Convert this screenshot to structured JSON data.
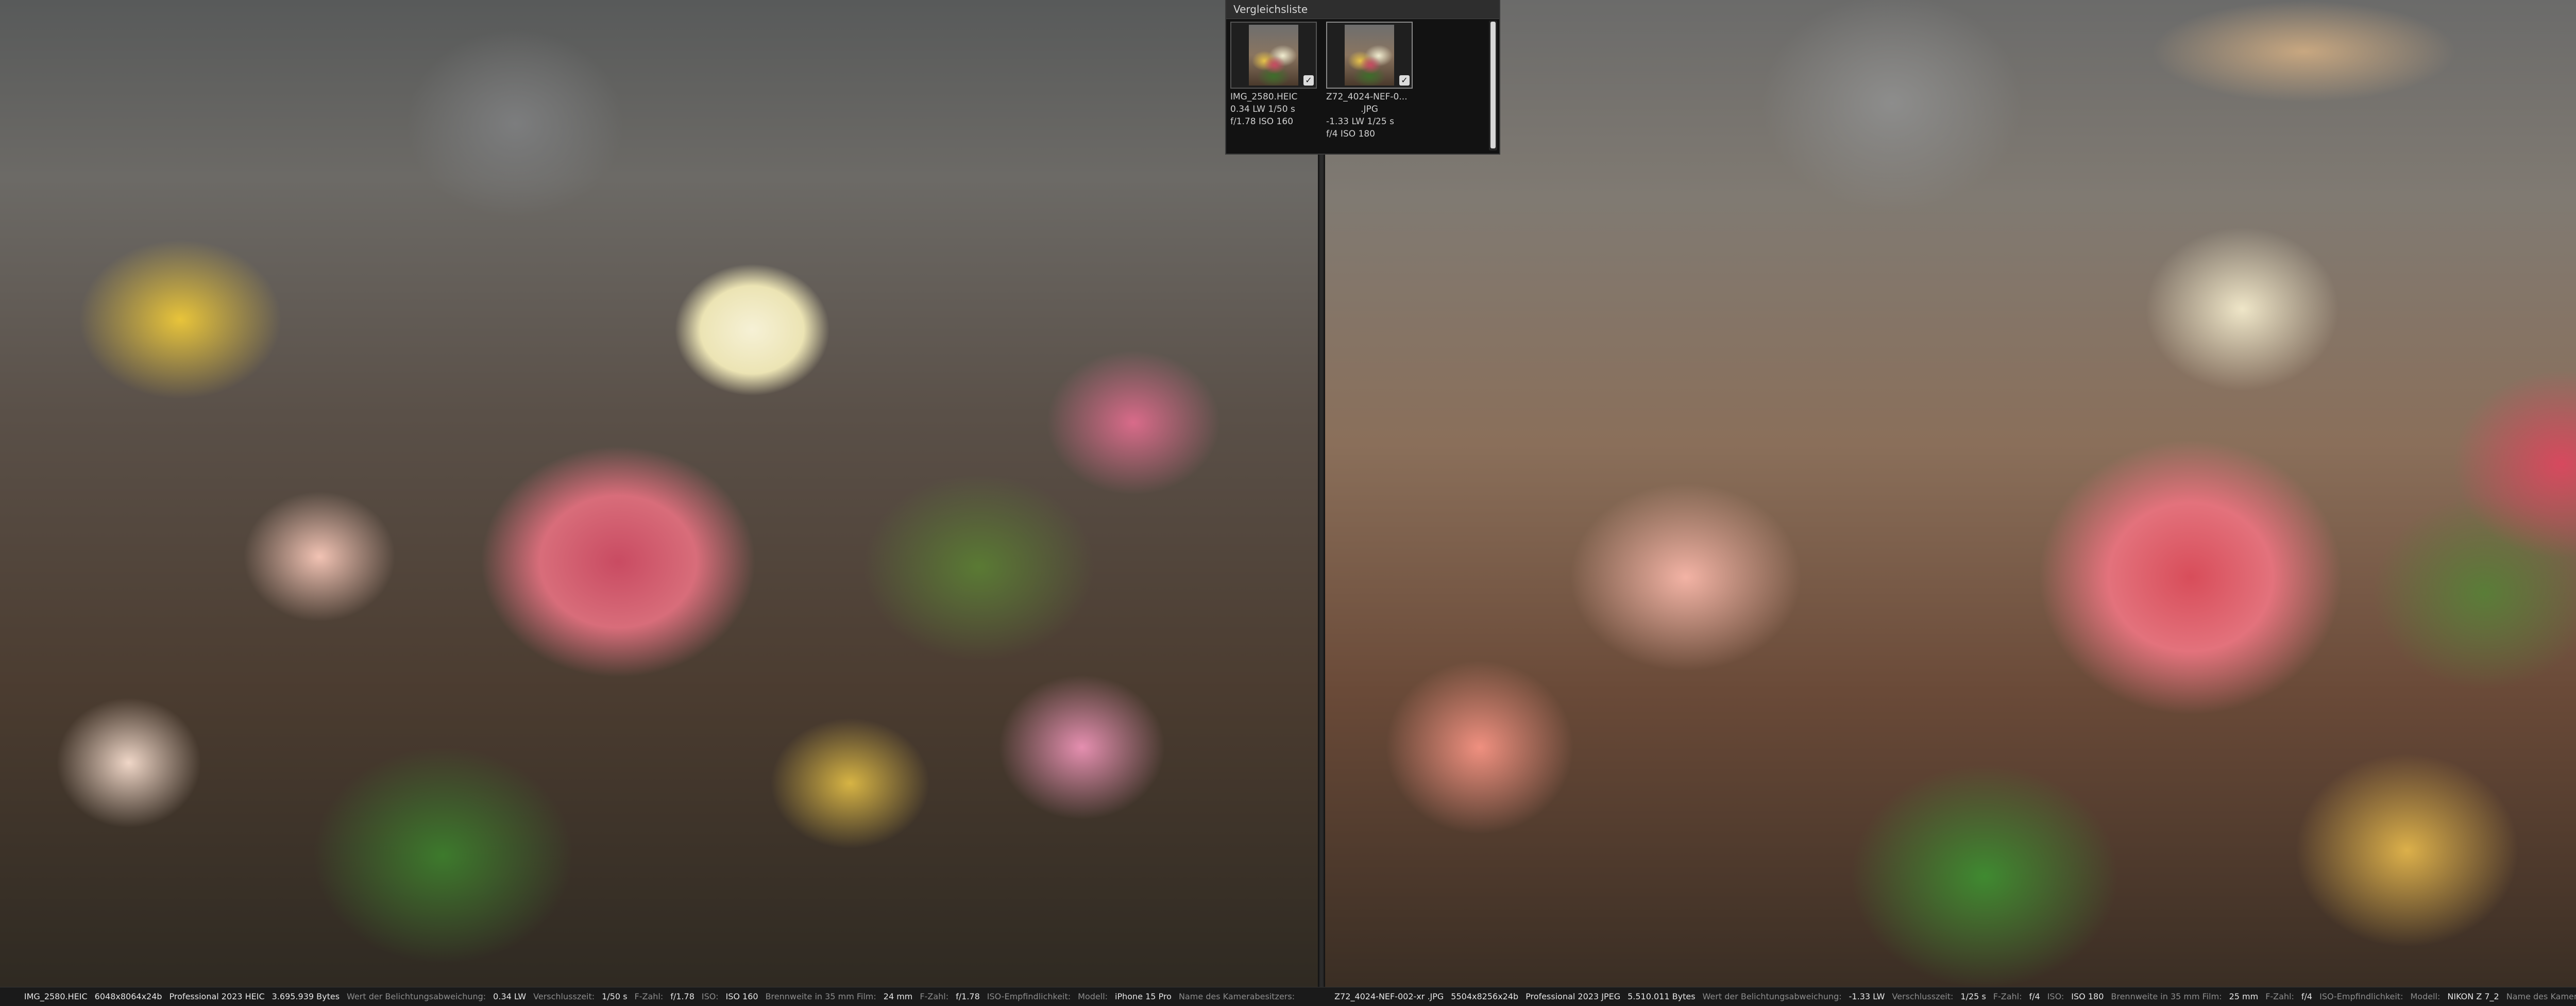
{
  "compare_panel": {
    "title": "Vergleichsliste",
    "items": [
      {
        "filename": "IMG_2580.HEIC",
        "line2": "0.34 LW   1/50 s",
        "line3": "f/1.78   ISO 160",
        "checked": "✓"
      },
      {
        "filename": "Z72_4024-NEF-0...",
        "line2": ".JPG",
        "line3": "-1.33 LW   1/25 s",
        "line4": "f/4   ISO 180",
        "checked": "✓"
      }
    ]
  },
  "infobar": {
    "left": {
      "filename": "IMG_2580.HEIC",
      "dims": "6048x8064x24b",
      "program": "Professional 2023 HEIC",
      "bytes": "3.695.939 Bytes",
      "ev_label": "Wert der Belichtungsabweichung:",
      "ev_value": "0.34 LW",
      "shutter_label": "Verschlusszeit:",
      "shutter_value": "1/50 s",
      "fnum_label": "F-Zahl:",
      "fnum_value": "f/1.78",
      "iso_label": "ISO:",
      "iso_value": "ISO 160",
      "focal_label": "Brennweite in 35 mm Film:",
      "focal_value": "24 mm",
      "fnum2_label": "F-Zahl:",
      "fnum2_value": "f/1.78",
      "iso2_label": "ISO-Empfindlichkeit:",
      "model_label": "Modell:",
      "model_value": "iPhone 15 Pro",
      "owner_label": "Name des Kamerabesitzers:"
    },
    "right": {
      "filename": "Z72_4024-NEF-002-xr .JPG",
      "dims": "5504x8256x24b",
      "program": "Professional 2023 JPEG",
      "bytes": "5.510.011 Bytes",
      "ev_label": "Wert der Belichtungsabweichung:",
      "ev_value": "-1.33 LW",
      "shutter_label": "Verschlusszeit:",
      "shutter_value": "1/25 s",
      "fnum_label": "F-Zahl:",
      "fnum_value": "f/4",
      "iso_label": "ISO:",
      "iso_value": "ISO 180",
      "focal_label": "Brennweite in 35 mm Film:",
      "focal_value": "25 mm",
      "fnum2_label": "F-Zahl:",
      "fnum2_value": "f/4",
      "iso2_label": "ISO-Empfindlichkeit:",
      "model_label": "Modell:",
      "model_value": "NIKON Z 7_2",
      "owner_label": "Name des Kamerabesitzers:"
    }
  }
}
